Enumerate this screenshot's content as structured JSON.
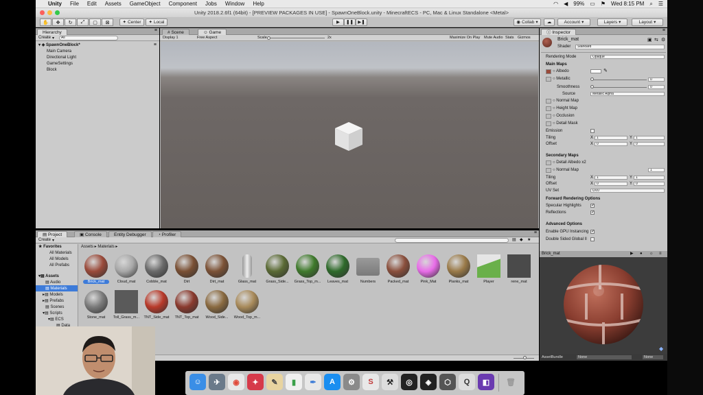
{
  "menubar": {
    "apple": "",
    "app": "Unity",
    "items": [
      "File",
      "Edit",
      "Assets",
      "GameObject",
      "Component",
      "Jobs",
      "Window",
      "Help"
    ],
    "battery": "99%",
    "clock": "Wed 8:15 PM"
  },
  "window": {
    "title": "Unity 2018.2.6f1 (64bit) - [PREVIEW PACKAGES IN USE] - SpawnOneBlock.unity - MinecraftECS - PC, Mac & Linux Standalone <Metal>"
  },
  "toolbar": {
    "pivot": "Center",
    "space": "Local",
    "collab": "Collab",
    "account": "Account",
    "layers": "Layers",
    "layout": "Layout"
  },
  "hierarchy": {
    "tab": "Hierarchy",
    "create": "Create",
    "search_placeholder": "All",
    "scene": "SpawnOneBlock*",
    "items": [
      "Main Camera",
      "Directional Light",
      "GameSettings",
      "Block"
    ]
  },
  "scene_view": {
    "tabs": [
      "Scene",
      "Game"
    ],
    "display": "Display 1",
    "aspect": "Free Aspect",
    "scale_label": "Scale",
    "scale_value": "2x",
    "options": [
      "Maximize On Play",
      "Mute Audio",
      "Stats",
      "Gizmos"
    ]
  },
  "inspector": {
    "tab": "Inspector",
    "name": "Brick_mat",
    "shader_label": "Shader",
    "shader": "Standard",
    "rendering_mode_label": "Rendering Mode",
    "rendering_mode": "Opaque",
    "main_maps": "Main Maps",
    "albedo": "Albedo",
    "metallic": "Metallic",
    "metallic_value": "0",
    "smoothness": "Smoothness",
    "smoothness_value": "0",
    "source": "Source",
    "source_value": "Metallic Alpha",
    "normal_map": "Normal Map",
    "height_map": "Height Map",
    "occlusion": "Occlusion",
    "detail_mask": "Detail Mask",
    "emission": "Emission",
    "tiling": "Tiling",
    "offset": "Offset",
    "x": "X",
    "y": "Y",
    "tiling_x": "1",
    "tiling_y": "1",
    "offset_x": "0",
    "offset_y": "0",
    "secondary_maps": "Secondary Maps",
    "detail_albedo": "Detail Albedo x2",
    "normal_map2": "Normal Map",
    "normal_map2_value": "1",
    "tiling2_x": "1",
    "tiling2_y": "1",
    "offset2_x": "0",
    "offset2_y": "0",
    "uv_set_label": "UV Set",
    "uv_set": "UV0",
    "forward_options": "Forward Rendering Options",
    "specular": "Specular Highlights",
    "reflections": "Reflections",
    "advanced": "Advanced Options",
    "gpu_instancing": "Enable GPU Instancing",
    "double_sided": "Double Sided Global Il",
    "preview_title": "Brick_mat",
    "asset_bundle": "AssetBundle",
    "bundle_value": "None",
    "bundle_variant": "None"
  },
  "project": {
    "tabs": [
      "Project",
      "Console",
      "Entity Debugger",
      "Profiler"
    ],
    "create": "Create",
    "favorites": "Favorites",
    "favorites_items": [
      "All Materials",
      "All Models",
      "All Prefabs"
    ],
    "assets": "Assets",
    "tree": [
      "Audio",
      "Materials",
      "Models",
      "Prefabs",
      "Scenes",
      "Scripts",
      "ECS",
      "Data"
    ],
    "breadcrumb": [
      "Assets",
      "Materials"
    ],
    "materials": [
      {
        "name": "Brick_mat",
        "color": "#9a4a3a"
      },
      {
        "name": "Cloud_mat",
        "color": "#a8a8a8"
      },
      {
        "name": "Cobble_mat",
        "color": "#6a6a6a"
      },
      {
        "name": "Dirt",
        "color": "#7a5034"
      },
      {
        "name": "Dirt_mat",
        "color": "#7c5236"
      },
      {
        "name": "Glass_mat",
        "color": "#d8d8d8"
      },
      {
        "name": "Grass_Side...",
        "color": "#5a6a34"
      },
      {
        "name": "Grass_Top_m...",
        "color": "#3f7a2c"
      },
      {
        "name": "Leaves_mat",
        "color": "#2e6a2a"
      },
      {
        "name": "Numbers",
        "color": "#8c8c8c"
      },
      {
        "name": "Packed_mat",
        "color": "#8a4f3c"
      },
      {
        "name": "Pink_Mat",
        "color": "#e86ce8"
      },
      {
        "name": "Planks_mat",
        "color": "#9a7a48"
      },
      {
        "name": "Player",
        "color": "#6ab04a"
      },
      {
        "name": "rene_mat",
        "color": "#4a4a4a"
      },
      {
        "name": "Stone_mat",
        "color": "#7a7a7a"
      },
      {
        "name": "Toll_Grass_m...",
        "color": "#5a5a5a"
      },
      {
        "name": "TNT_Side_mat",
        "color": "#b83a2a"
      },
      {
        "name": "TNT_Top_mat",
        "color": "#8a3a2e"
      },
      {
        "name": "Wood_Side...",
        "color": "#8a6a40"
      },
      {
        "name": "Wood_Top_m...",
        "color": "#a88a5a"
      }
    ]
  },
  "colors": {
    "scene_sky": "#b9bcc2",
    "scene_ground": "#6a6360",
    "selection": "#3d7bd9"
  }
}
